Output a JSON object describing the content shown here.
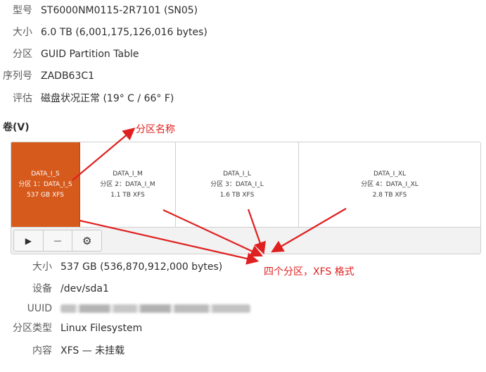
{
  "disk_info": [
    {
      "key": "型号",
      "value": "ST6000NM0115-2R7101 (SN05)"
    },
    {
      "key": "大小",
      "value": "6.0 TB (6,001,175,126,016 bytes)"
    },
    {
      "key": "分区",
      "value": "GUID Partition Table"
    },
    {
      "key": "序列号",
      "value": "ZADB63C1"
    },
    {
      "key": "评估",
      "value": "磁盘状况正常 (19° C / 66° F)"
    }
  ],
  "volumes_title": "卷(V)",
  "partitions": [
    {
      "name": "DATA_I_S",
      "label": "分区 1：DATA_I_S",
      "size": "537 GB XFS",
      "selected": true
    },
    {
      "name": "DATA_I_M",
      "label": "分区 2：DATA_I_M",
      "size": "1.1 TB XFS",
      "selected": false
    },
    {
      "name": "DATA_I_L",
      "label": "分区 3：DATA_I_L",
      "size": "1.6 TB XFS",
      "selected": false
    },
    {
      "name": "DATA_I_XL",
      "label": "分区 4：DATA_I_XL",
      "size": "2.8 TB XFS",
      "selected": false
    }
  ],
  "toolbar": {
    "play_glyph": "▶",
    "minus_glyph": "—",
    "gear_glyph": "⚙"
  },
  "partition_info": [
    {
      "key": "大小",
      "value": "537 GB (536,870,912,000 bytes)"
    },
    {
      "key": "设备",
      "value": "/dev/sda1"
    },
    {
      "key": "UUID",
      "value": ""
    },
    {
      "key": "分区类型",
      "value": "Linux Filesystem"
    },
    {
      "key": "内容",
      "value": "XFS — 未挂载"
    }
  ],
  "annotations": {
    "partition_name": "分区名称",
    "four_partitions": "四个分区，XFS 格式"
  },
  "colors": {
    "selected_partition": "#d65a1c",
    "annotation": "#e02020"
  },
  "icons": [
    "play-icon",
    "minus-icon",
    "gear-icon"
  ]
}
